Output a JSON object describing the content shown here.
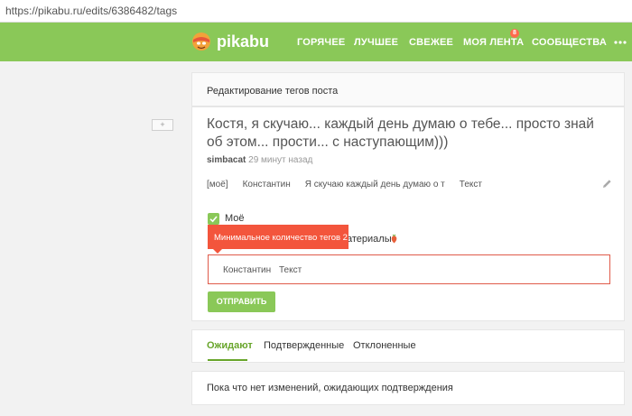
{
  "browser": {
    "url": "https://pikabu.ru/edits/6386482/tags"
  },
  "header": {
    "logo_text": "pikabu",
    "nav": [
      {
        "label": "ГОРЯЧЕЕ"
      },
      {
        "label": "ЛУЧШЕЕ"
      },
      {
        "label": "СВЕЖЕЕ"
      },
      {
        "label": "МОЯ ЛЕНТА",
        "badge": "8"
      },
      {
        "label": "СООБЩЕСТВА"
      }
    ],
    "more_icon": "more-dots-icon"
  },
  "collapse_button": {
    "label": "+"
  },
  "edit_card": {
    "title": "Редактирование тегов поста"
  },
  "post": {
    "title": "Костя, я скучаю... каждый день думаю о тебе... просто знай об этом... прости... с наступающим)))",
    "author": "simbacat",
    "time": "29 минут назад",
    "tags": [
      "[моё]",
      "Константин",
      "Я скучаю каждый день думаю о т",
      "Текст"
    ]
  },
  "form": {
    "checkbox_label": "Моё",
    "checkbox_checked": true,
    "second_label_fragment": "атериалы",
    "tooltip": "Минимальное количество тегов 2",
    "input_tags": [
      "Константин",
      "Текст"
    ],
    "submit_label": "ОТПРАВИТЬ"
  },
  "tabs": [
    {
      "label": "Ожидают",
      "active": true
    },
    {
      "label": "Подтвержденные",
      "active": false
    },
    {
      "label": "Отклоненные",
      "active": false
    }
  ],
  "empty_message": "Пока что нет изменений, ожидающих подтверждения",
  "colors": {
    "brand_green": "#8ac858",
    "tab_green": "#68a52b",
    "error_red": "#f3553c"
  }
}
